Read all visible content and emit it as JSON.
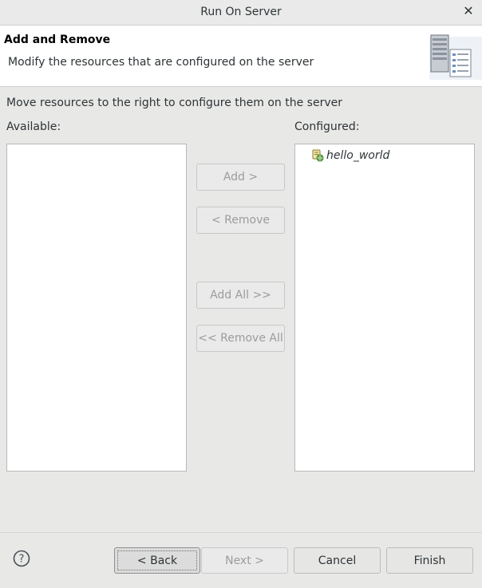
{
  "window": {
    "title": "Run On Server",
    "close_label": "✕"
  },
  "banner": {
    "heading": "Add and Remove",
    "description": "Modify the resources that are configured on the server",
    "image_icon": "server-wizard-icon"
  },
  "instruction": "Move resources to the right to configure them on the server",
  "available": {
    "label": "Available:",
    "items": []
  },
  "configured": {
    "label": "Configured:",
    "items": [
      {
        "label": "hello_world",
        "icon": "web-project-icon"
      }
    ]
  },
  "buttons": {
    "add": "Add >",
    "remove": "< Remove",
    "add_all": "Add All >>",
    "remove_all": "<< Remove All",
    "back": "< Back",
    "next": "Next >",
    "cancel": "Cancel",
    "finish": "Finish"
  },
  "help_icon": "help-icon",
  "colors": {
    "background": "#e8e8e7",
    "banner_background": "#ffffff",
    "disabled_text": "#9a9d9a",
    "text": "#2e3436"
  }
}
